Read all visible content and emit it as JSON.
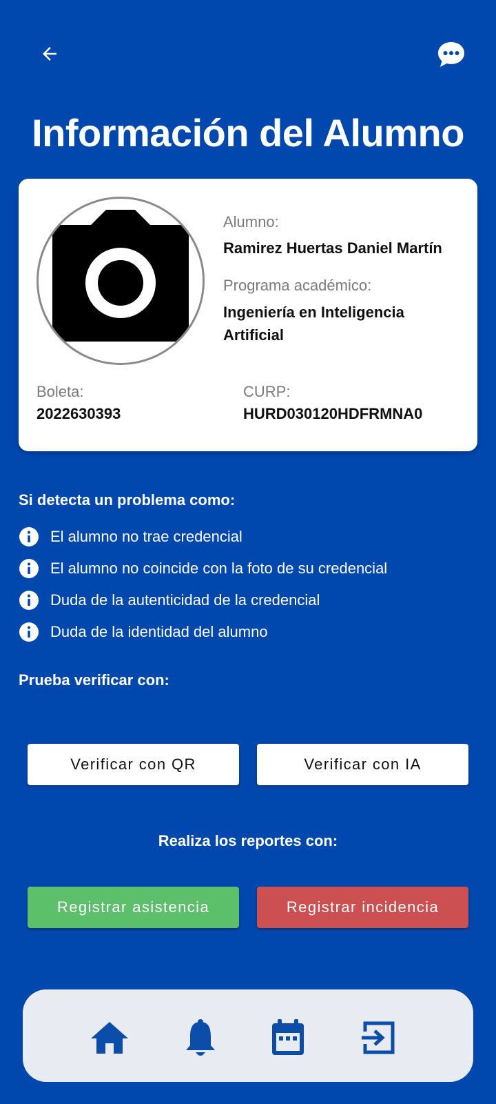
{
  "header": {
    "back_icon": "arrow-left-icon",
    "chat_icon": "chat-bubble-dots-icon",
    "title": "Información del Alumno"
  },
  "student_card": {
    "photo_icon": "camera-icon",
    "alumno_label": "Alumno:",
    "alumno_name": "Ramirez Huertas Daniel Martín",
    "programa_label": "Programa académico:",
    "programa_line1": "Ingeniería en Inteligencia",
    "programa_line2": "Artificial",
    "boleta_label": "Boleta:",
    "boleta_value": "2022630393",
    "curp_label": "CURP:",
    "curp_value": "HURD030120HDFRMNA0"
  },
  "problems": {
    "title": "Si detecta un problema como:",
    "icon": "info-circle-icon",
    "items": [
      "El alumno no trae credencial",
      "El alumno no coincide con la foto de su credencial",
      "Duda de la autenticidad de la credencial",
      "Duda de la identidad del alumno"
    ]
  },
  "verify": {
    "title": "Prueba verificar con:",
    "qr_label": "Verificar con QR",
    "ia_label": "Verificar con IA"
  },
  "reports": {
    "title": "Realiza los reportes con:",
    "asistencia_label": "Registrar asistencia",
    "incidencia_label": "Registrar incidencia"
  },
  "bottom_nav": {
    "items": [
      "home-icon",
      "bell-icon",
      "calendar-icon",
      "logout-icon"
    ]
  },
  "colors": {
    "background": "#0048AE",
    "icon_blue": "#0B4DA8",
    "green": "#5CBF6A",
    "red": "#CC5052",
    "nav_bg": "#E8EBF2"
  }
}
